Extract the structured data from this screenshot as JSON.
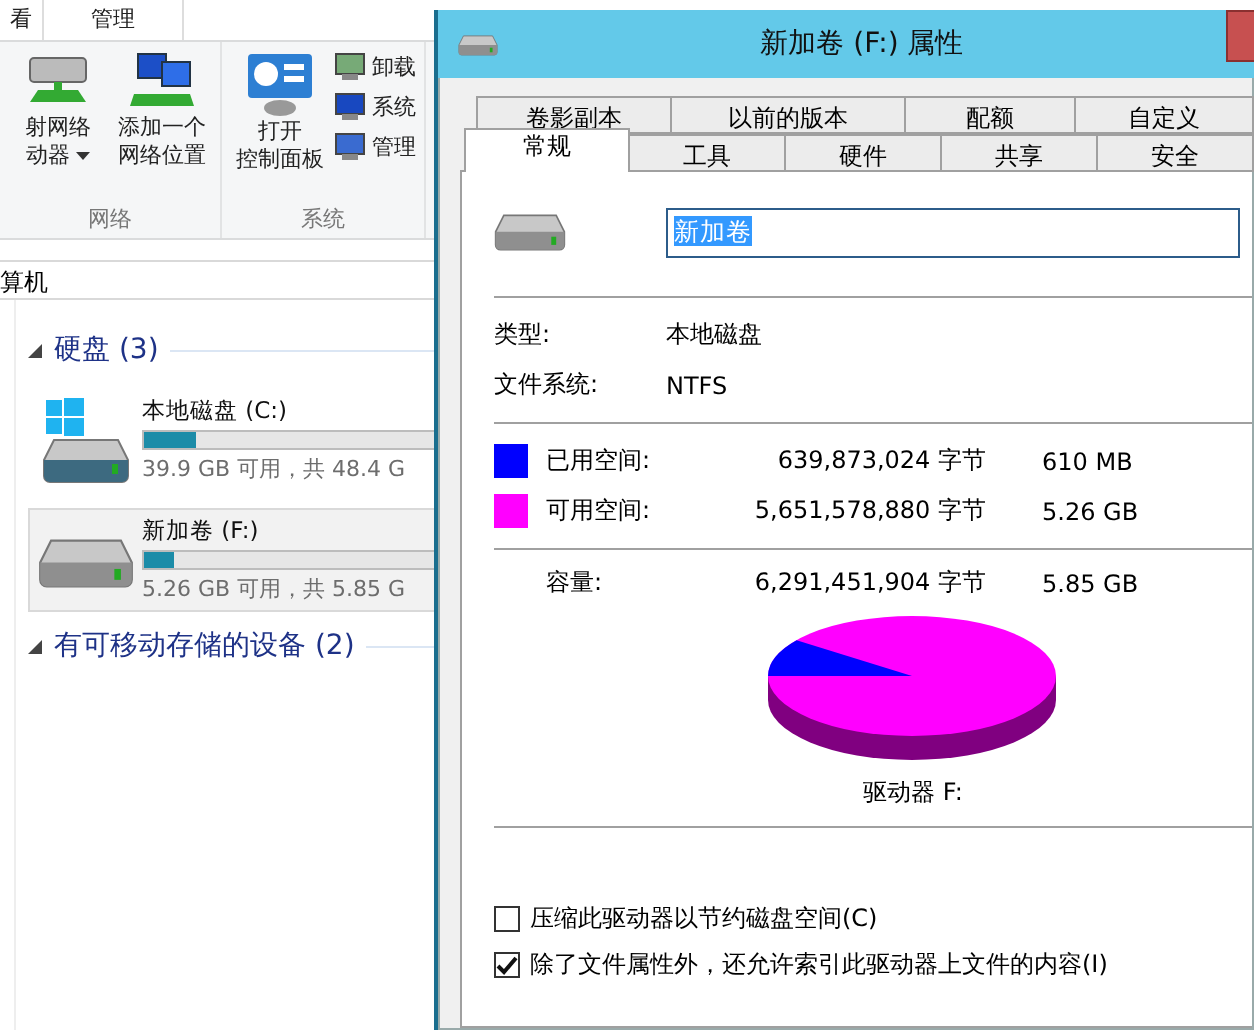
{
  "explorer": {
    "ribbon_tabs": [
      "看",
      "管理"
    ],
    "ribbon_groups": [
      {
        "name": "网络",
        "large_buttons": [
          {
            "lines": [
              "射网络",
              "动器"
            ],
            "dropdown": true
          },
          {
            "lines": [
              "添加一个",
              "网络位置"
            ],
            "dropdown": false
          }
        ]
      },
      {
        "name": "系统",
        "large_buttons": [
          {
            "lines": [
              "打开",
              "控制面板"
            ],
            "dropdown": false
          }
        ],
        "small_buttons": [
          "卸载",
          "系统",
          "管理"
        ]
      }
    ],
    "address": "算机",
    "groups": [
      {
        "title": "硬盘 (3)",
        "expanded": true,
        "drives": [
          {
            "name": "本地磁盘 (C:)",
            "kind": "system",
            "level": 0.18,
            "free": "39.9 GB 可用，共 48.4 G",
            "selected": false
          },
          {
            "name": "新加卷 (F:)",
            "kind": "data",
            "level": 0.1,
            "free": "5.26 GB 可用，共 5.85 G",
            "selected": true
          }
        ]
      },
      {
        "title": "有可移动存储的设备 (2)",
        "expanded": true
      }
    ]
  },
  "dialog": {
    "title": "新加卷 (F:) 属性",
    "tab_rows": [
      [
        {
          "label": "卷影副本",
          "selected": false
        },
        {
          "label": "以前的版本",
          "selected": false
        },
        {
          "label": "配额",
          "selected": false
        },
        {
          "label": "自定义",
          "selected": false
        }
      ],
      [
        {
          "label": "常规",
          "selected": true
        },
        {
          "label": "工具",
          "selected": false
        },
        {
          "label": "硬件",
          "selected": false
        },
        {
          "label": "共享",
          "selected": false
        },
        {
          "label": "安全",
          "selected": false
        }
      ]
    ],
    "volume_name": "新加卷",
    "info": [
      {
        "label": "类型:",
        "value": "本地磁盘"
      },
      {
        "label": "文件系统:",
        "value": "NTFS"
      }
    ],
    "space": [
      {
        "label": "已用空间:",
        "bytes": "639,873,024 字节",
        "size": "610 MB",
        "color": "#0000ff"
      },
      {
        "label": "可用空间:",
        "bytes": "5,651,578,880 字节",
        "size": "5.26 GB",
        "color": "#ff00ff"
      }
    ],
    "capacity": {
      "label": "容量:",
      "bytes": "6,291,451,904 字节",
      "size": "5.85 GB"
    },
    "drive_label": "驱动器 F:",
    "options": [
      {
        "label": "压缩此驱动器以节约磁盘空间(C)",
        "checked": false
      },
      {
        "label": "除了文件属性外，还允许索引此驱动器上文件的内容(I)",
        "checked": true
      }
    ]
  }
}
